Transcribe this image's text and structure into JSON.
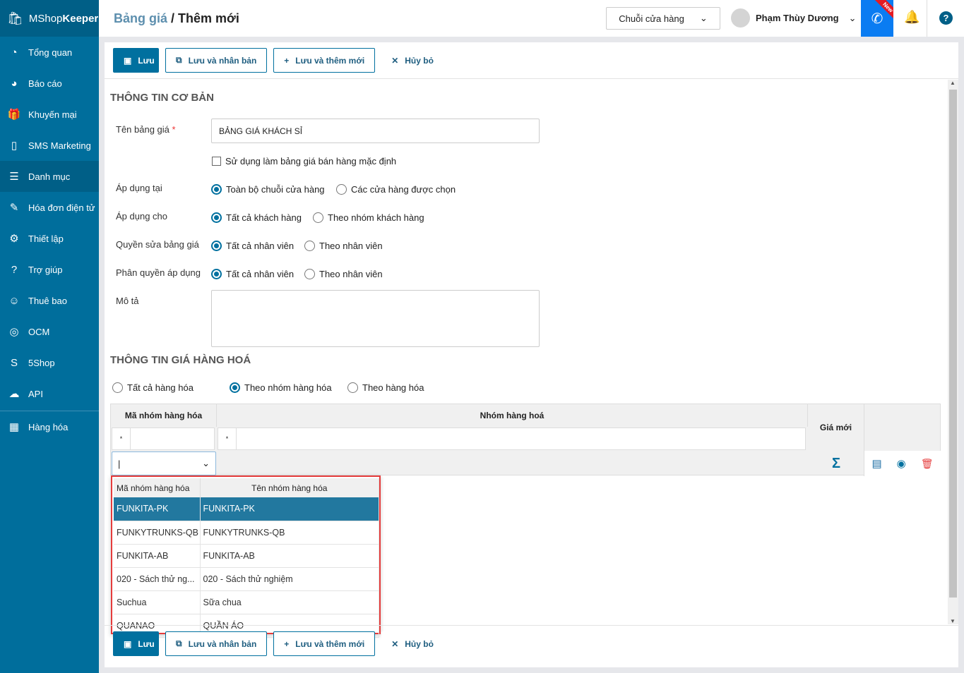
{
  "app": {
    "brand_light": "MShop",
    "brand_bold": "Keeper"
  },
  "sidebar": {
    "items": [
      {
        "label": "Tổng quan",
        "icon": "dashboard-icon",
        "glyph": "◔"
      },
      {
        "label": "Báo cáo",
        "icon": "pie-chart-icon",
        "glyph": "◕"
      },
      {
        "label": "Khuyến mại",
        "icon": "gift-icon",
        "glyph": "🎁"
      },
      {
        "label": "SMS Marketing",
        "icon": "mobile-icon",
        "glyph": "▯"
      },
      {
        "label": "Danh mục",
        "icon": "list-icon",
        "glyph": "☰"
      },
      {
        "label": "Hóa đơn điện tử",
        "icon": "invoice-icon",
        "glyph": "✎"
      },
      {
        "label": "Thiết lập",
        "icon": "gear-icon",
        "glyph": "⚙"
      },
      {
        "label": "Trợ giúp",
        "icon": "help-icon",
        "glyph": "?"
      },
      {
        "label": "Thuê bao",
        "icon": "user-icon",
        "glyph": "☺"
      },
      {
        "label": "OCM",
        "icon": "ocm-icon",
        "glyph": "◎"
      },
      {
        "label": "5Shop",
        "icon": "5shop-icon",
        "glyph": "S"
      },
      {
        "label": "API",
        "icon": "cloud-upload-icon",
        "glyph": "☁"
      },
      {
        "label": "Hàng hóa",
        "icon": "boxes-icon",
        "glyph": "▦"
      }
    ]
  },
  "header": {
    "crumb": "Bảng giá",
    "sep": " / ",
    "title": "Thêm mới",
    "store_select": "Chuỗi cửa hàng",
    "user": "Phạm Thùy Dương",
    "new_badge": "New",
    "help": "?"
  },
  "toolbar": {
    "save": "Lưu",
    "save_copy": "Lưu và nhân bản",
    "save_new": "Lưu và thêm mới",
    "cancel": "Hủy bỏ"
  },
  "basic": {
    "section": "THÔNG TIN CƠ BẢN",
    "name_label": "Tên bảng giá",
    "required": "*",
    "name_value": "BẢNG GIÁ KHÁCH SỈ",
    "default_checkbox": "Sử dụng làm bảng giá bán hàng mặc định",
    "apply_at_label": "Áp dụng tại",
    "apply_at": [
      "Toàn bộ chuỗi cửa hàng",
      "Các cửa hàng được chọn"
    ],
    "apply_for_label": "Áp dụng cho",
    "apply_for": [
      "Tất cả khách hàng",
      "Theo nhóm khách hàng"
    ],
    "edit_perm_label": "Quyền sửa bảng giá",
    "edit_perm": [
      "Tất cả nhân viên",
      "Theo nhân viên"
    ],
    "use_perm_label": "Phân quyền áp dụng",
    "use_perm": [
      "Tất cả nhân viên",
      "Theo nhân viên"
    ],
    "desc_label": "Mô tả"
  },
  "price": {
    "section": "THÔNG TIN GIÁ HÀNG HOÁ",
    "modes": [
      "Tất cả hàng hóa",
      "Theo nhóm hàng hóa",
      "Theo hàng hóa"
    ],
    "selected_mode": 1,
    "grid": {
      "col_code": "Mã nhóm hàng hóa",
      "col_group": "Nhóm hàng hoá",
      "col_price": "Giá mới",
      "filter_op": "*",
      "sum": "Σ"
    },
    "dropdown": {
      "headers": [
        "Mã nhóm hàng hóa",
        "Tên nhóm hàng hóa"
      ],
      "rows": [
        [
          "FUNKITA-PK",
          "FUNKITA-PK"
        ],
        [
          "FUNKYTRUNKS-QB",
          "FUNKYTRUNKS-QB"
        ],
        [
          "FUNKITA-AB",
          "FUNKITA-AB"
        ],
        [
          "020 - Sách thử ng...",
          "020 - Sách thử nghiệm"
        ],
        [
          "Suchua",
          "Sữa chua"
        ],
        [
          "QUANAO",
          "QUẦN ÁO"
        ]
      ]
    }
  }
}
